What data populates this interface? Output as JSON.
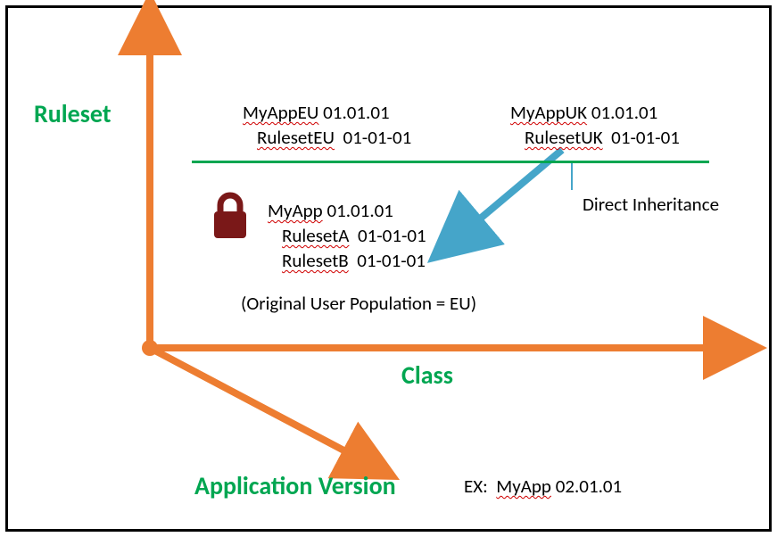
{
  "axis": {
    "y_label": "Ruleset",
    "x_label": "Class",
    "z_label": "Application Version"
  },
  "eu": {
    "app": "MyAppEU",
    "app_ver": "01.01.01",
    "ruleset": "RulesetEU",
    "ruleset_ver": "01-01-01"
  },
  "uk": {
    "app": "MyAppUK",
    "app_ver": "01.01.01",
    "ruleset": "RulesetUK",
    "ruleset_ver": "01-01-01"
  },
  "base": {
    "app": "MyApp",
    "app_ver": "01.01.01",
    "ruleset_a": "RulesetA",
    "ruleset_a_ver": "01-01-01",
    "ruleset_b": "RulesetB",
    "ruleset_b_ver": "01-01-01"
  },
  "note": "(Original User Population = EU)",
  "inheritance_label": "Direct Inheritance",
  "example": {
    "prefix": "EX:",
    "app": "MyApp",
    "ver": "02.01.01"
  },
  "colors": {
    "green": "#00a651",
    "orange": "#ed7d31",
    "blue": "#45a5c9",
    "lock": "#7a1818"
  },
  "icons": {
    "lock": "lock-icon"
  }
}
